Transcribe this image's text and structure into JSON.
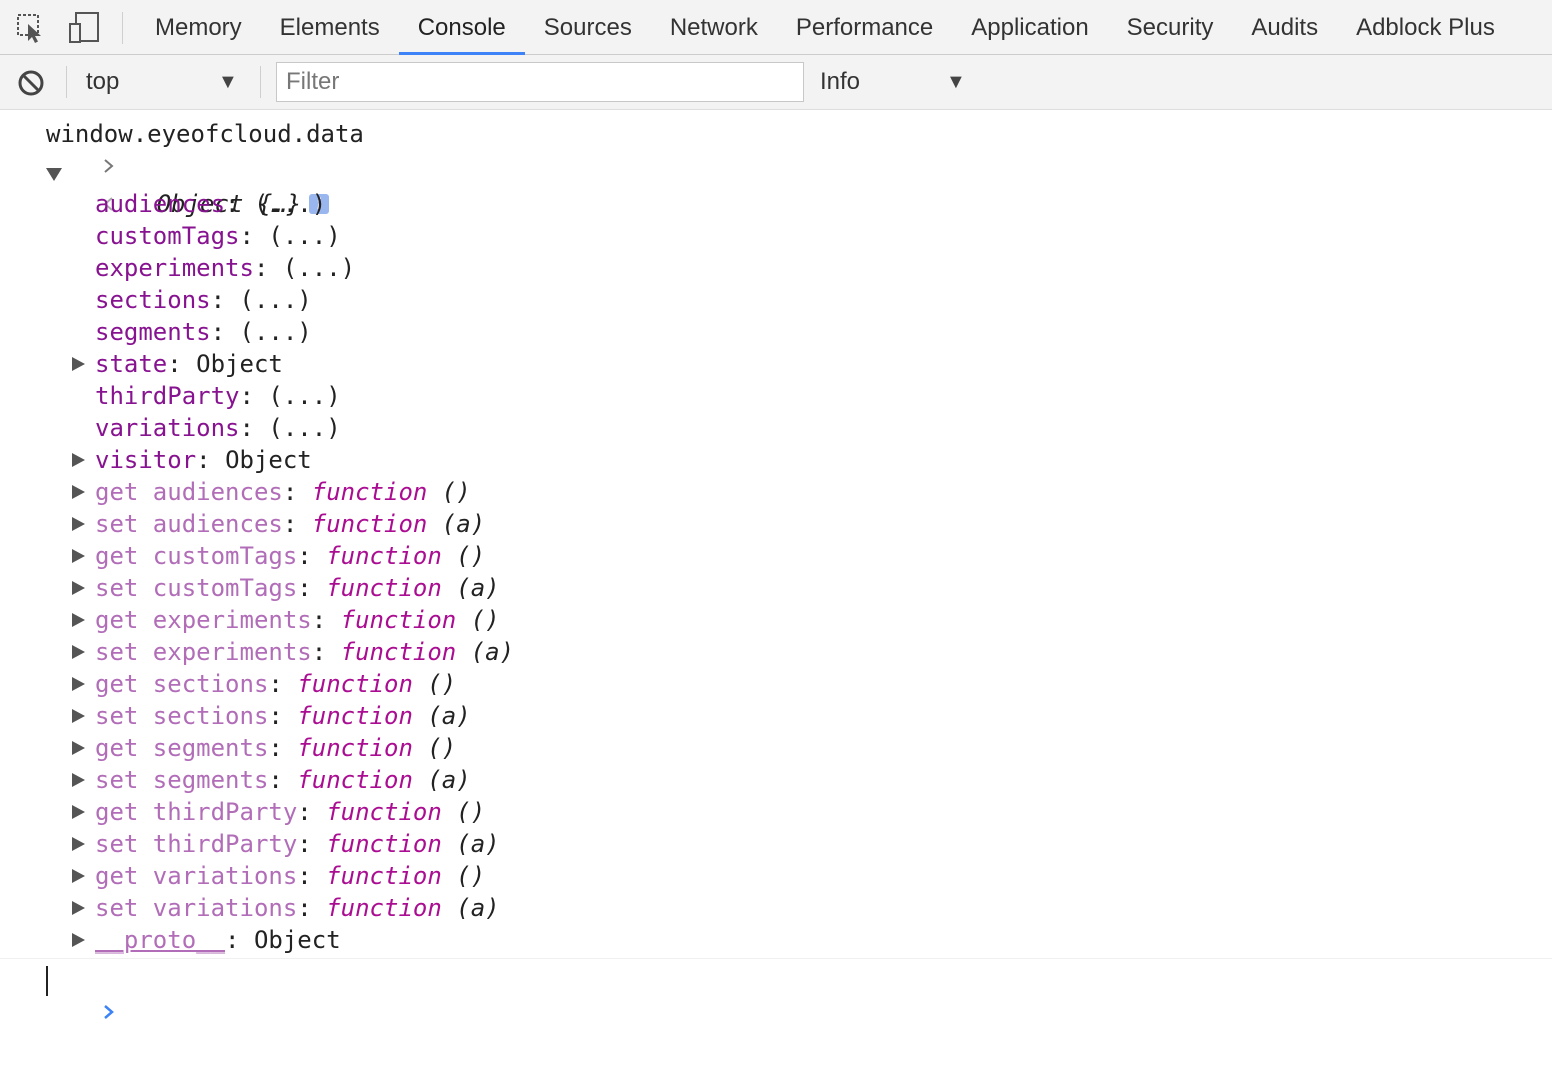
{
  "toolbar": {
    "inspect_icon": "inspect-element-icon",
    "device_icon": "device-toolbar-icon",
    "tabs": [
      "Memory",
      "Elements",
      "Console",
      "Sources",
      "Network",
      "Performance",
      "Application",
      "Security",
      "Audits",
      "Adblock Plus"
    ],
    "active_tab": "Console"
  },
  "filterbar": {
    "clear_icon": "clear-console-icon",
    "context": "top",
    "filter_placeholder": "Filter",
    "filter_value": "",
    "level": "Info"
  },
  "console": {
    "input": "window.eyeofcloud.data",
    "result_label": "Object {…}",
    "info_icon": "i",
    "properties": [
      {
        "key": "audiences",
        "value": "(...)"
      },
      {
        "key": "customTags",
        "value": "(...)"
      },
      {
        "key": "experiments",
        "value": "(...)"
      },
      {
        "key": "sections",
        "value": "(...)"
      },
      {
        "key": "segments",
        "value": "(...)"
      },
      {
        "key": "state",
        "value": "Object"
      },
      {
        "key": "thirdParty",
        "value": "(...)"
      },
      {
        "key": "variations",
        "value": "(...)"
      },
      {
        "key": "visitor",
        "value": "Object"
      }
    ],
    "accessors": [
      {
        "key": "get audiences",
        "fn": "function",
        "args": "()"
      },
      {
        "key": "set audiences",
        "fn": "function",
        "args": "(a)"
      },
      {
        "key": "get customTags",
        "fn": "function",
        "args": "()"
      },
      {
        "key": "set customTags",
        "fn": "function",
        "args": "(a)"
      },
      {
        "key": "get experiments",
        "fn": "function",
        "args": "()"
      },
      {
        "key": "set experiments",
        "fn": "function",
        "args": "(a)"
      },
      {
        "key": "get sections",
        "fn": "function",
        "args": "()"
      },
      {
        "key": "set sections",
        "fn": "function",
        "args": "(a)"
      },
      {
        "key": "get segments",
        "fn": "function",
        "args": "()"
      },
      {
        "key": "set segments",
        "fn": "function",
        "args": "(a)"
      },
      {
        "key": "get thirdParty",
        "fn": "function",
        "args": "()"
      },
      {
        "key": "set thirdParty",
        "fn": "function",
        "args": "(a)"
      },
      {
        "key": "get variations",
        "fn": "function",
        "args": "()"
      },
      {
        "key": "set variations",
        "fn": "function",
        "args": "(a)"
      }
    ],
    "proto": {
      "key": "__proto__",
      "value": "Object"
    }
  },
  "colors": {
    "active_tab_underline": "#3e82f7",
    "key": "#881391",
    "dim_key": "#b16db7",
    "function": "#aa0d91",
    "prompt": "#3e82f7"
  }
}
